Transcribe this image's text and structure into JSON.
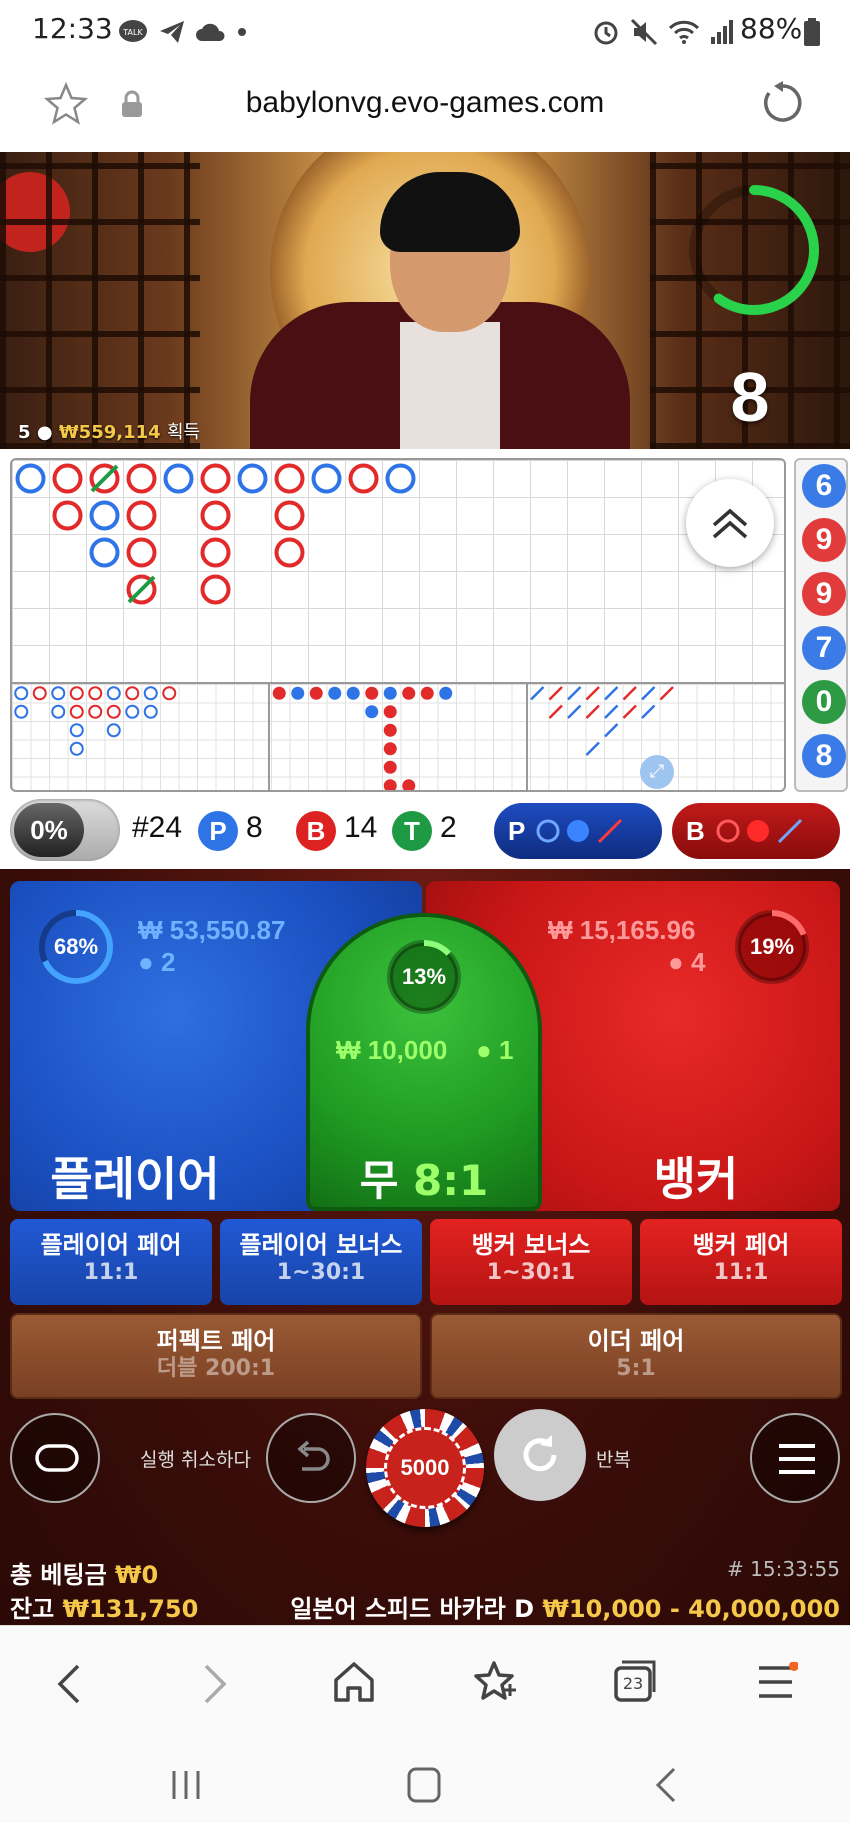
{
  "status_bar": {
    "time": "12:33",
    "battery": "88%",
    "icons": [
      "kakaotalk-icon",
      "telegram-icon",
      "cloud-icon",
      "dot-icon",
      "alarm-icon",
      "mute-icon",
      "wifi-icon",
      "signal-icon",
      "battery-icon"
    ]
  },
  "browser": {
    "url": "babylonvg.evo-games.com",
    "icons": [
      "star-icon",
      "lock-icon",
      "reload-icon"
    ]
  },
  "video": {
    "players": "5",
    "winnings": "₩559,114",
    "winnings_label": "획득",
    "timer": "8",
    "timer_fraction": 0.6
  },
  "roadmap": {
    "bead_column": [
      {
        "value": "6",
        "color": "#3a7be8"
      },
      {
        "value": "9",
        "color": "#e23b3b"
      },
      {
        "value": "9",
        "color": "#e23b3b"
      },
      {
        "value": "7",
        "color": "#3a7be8"
      },
      {
        "value": "0",
        "color": "#2f9a44"
      },
      {
        "value": "8",
        "color": "#3a7be8"
      }
    ]
  },
  "stats": {
    "percent": "0%",
    "round": "#24",
    "player_letter": "P",
    "player_count": "8",
    "banker_letter": "B",
    "banker_count": "14",
    "tie_letter": "T",
    "tie_count": "2",
    "predict_player": "P",
    "predict_banker": "B"
  },
  "bets": {
    "player": {
      "percent": "68%",
      "percent_value": 0.68,
      "amount": "₩ 53,550.87",
      "count": "2",
      "title": "플레이어"
    },
    "tie": {
      "percent": "13%",
      "percent_value": 0.13,
      "amount": "₩ 10,000",
      "count": "1",
      "title": "무",
      "odds": "8:1"
    },
    "banker": {
      "percent": "19%",
      "percent_value": 0.19,
      "amount": "₩ 15,165.96",
      "count": "4",
      "title": "뱅커"
    },
    "side": [
      {
        "label": "플레이어 페어",
        "odds": "11:1"
      },
      {
        "label": "플레이어 보너스",
        "odds": "1~30:1"
      },
      {
        "label": "뱅커 보너스",
        "odds": "1~30:1"
      },
      {
        "label": "뱅커 페어",
        "odds": "11:1"
      }
    ],
    "perfect_pair": {
      "label": "퍼펙트 페어",
      "odds": "더블 200:1"
    },
    "either_pair": {
      "label": "이더 페어",
      "odds": "5:1"
    }
  },
  "controls": {
    "undo_label": "실행 취소하다",
    "chip_value": "5000",
    "repeat_label": "반복"
  },
  "footer": {
    "total_bet_label": "총 베팅금",
    "total_bet": "₩0",
    "balance_label": "잔고",
    "balance": "₩131,750",
    "game_id": "# 15:33:55",
    "table_name": "일본어 스피드 바카라 D",
    "limits": "₩10,000 - 40,000,000"
  },
  "bottom_nav": {
    "tabs_count": "23",
    "icons": [
      "back-icon",
      "forward-icon",
      "home-icon",
      "bookmarks-icon",
      "tabs-icon",
      "menu-icon"
    ]
  },
  "colors": {
    "player": "#1a4fc0",
    "banker": "#c81616",
    "tie": "#1f9a22",
    "gold": "#f6c84a"
  }
}
